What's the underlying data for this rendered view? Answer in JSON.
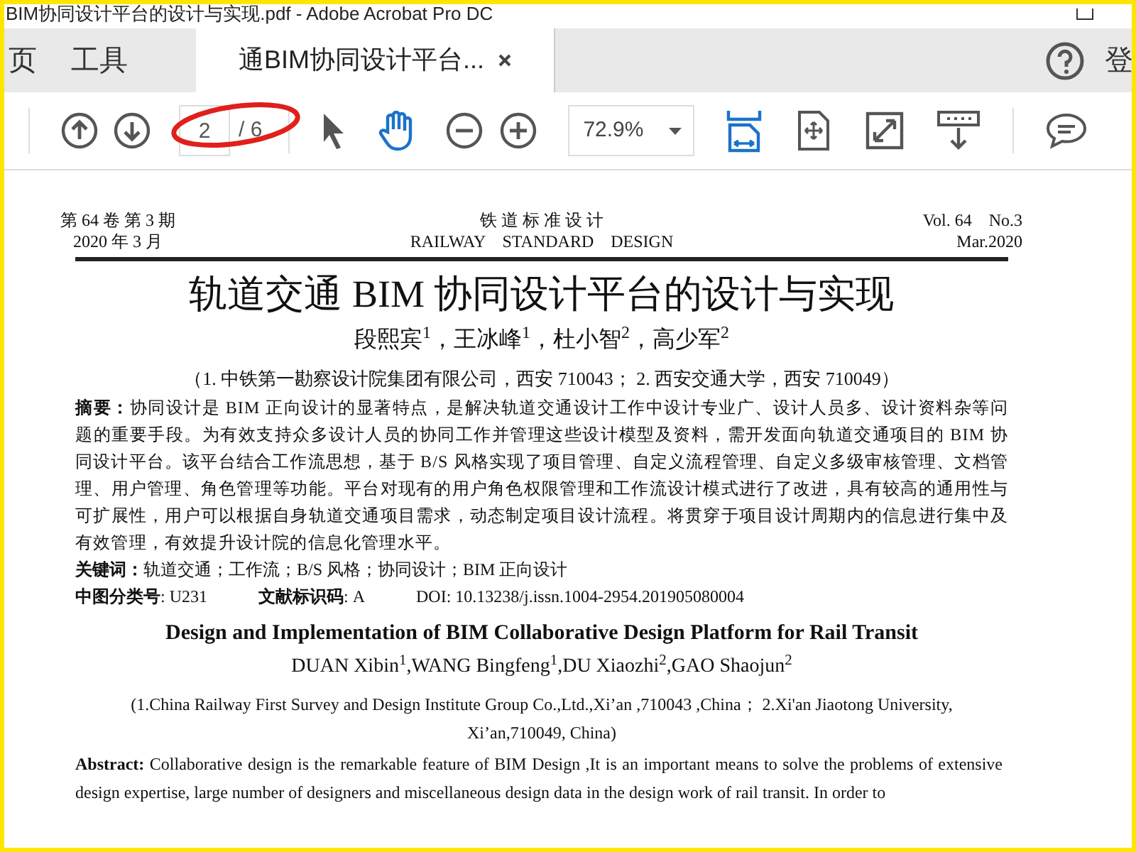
{
  "window": {
    "title": "BIM协同设计平台的设计与实现.pdf - Adobe Acrobat Pro DC"
  },
  "tabs": [
    {
      "label": "页",
      "selected": false,
      "closable": false
    },
    {
      "label": "工具",
      "selected": false,
      "closable": false
    },
    {
      "label": "通BIM协同设计平台...",
      "selected": true,
      "closable": true
    }
  ],
  "top_right": {
    "login_label": "登"
  },
  "toolbar": {
    "page_value": "2",
    "page_total": "/ 6",
    "zoom": "72.9%"
  },
  "document": {
    "header_left": [
      "第 64 卷 第 3 期",
      "2020 年 3 月"
    ],
    "header_center": [
      "铁 道 标 准 设 计",
      "RAILWAY    STANDARD    DESIGN"
    ],
    "header_right": [
      "Vol. 64    No.3",
      "Mar.2020"
    ],
    "title": "轨道交通 BIM 协同设计平台的设计与实现",
    "authors": "段熙宾$^{1}$，王冰峰$^{1}$，杜小智$^{2}$，高少军$^{2}$",
    "affiliations": "（1. 中铁第一勘察设计院集团有限公司，西安  710043；  2.  西安交通大学，西安  710049）",
    "abstract": "**摘要：**协同设计是 BIM 正向设计的显著特点，是解决轨道交通设计工作中设计专业广、设计人员多、设计资料杂等问题的重要手段。为有效支持众多设计人员的协同工作并管理这些设计模型及资料，需开发面向轨道交通项目的 BIM 协同设计平台。该平台结合工作流思想，基于 B/S 风格实现了项目管理、自定义流程管理、自定义多级审核管理、文档管理、用户管理、角色管理等功能。平台对现有的用户角色权限管理和工作流设计模式进行了改进，具有较高的通用性与可扩展性，用户可以根据自身轨道交通项目需求，动态制定项目设计流程。将贯穿于项目设计周期内的信息进行集中及有效管理，有效提升设计院的信息化管理水平。",
    "keywords": "**关键词：**轨道交通；工作流；B/S 风格；协同设计；BIM 正向设计",
    "classification": [
      "**中图分类号**: U231",
      "**文献标识码**: A",
      "DOI: 10.13238/j.issn.1004-2954.201905080004"
    ],
    "en_title": "Design and Implementation of BIM Collaborative Design Platform for Rail Transit",
    "en_authors": "DUAN Xibin$^{1}$,WANG Bingfeng$^{1}$,DU Xiaozhi$^{2}$,GAO Shaojun$^{2}$",
    "en_affiliations": "(1.China Railway First Survey and Design Institute Group Co.,Ltd.,Xi’an ,710043 ,China；  2.Xi'an Jiaotong University, Xi’an,710049, China)",
    "en_abstract": "**Abstract:** Collaborative design is the remarkable feature of BIM Design ,It is an important means to solve the problems of extensive design expertise, large number of designers and miscellaneous design data in the design work of rail transit. In order to"
  }
}
